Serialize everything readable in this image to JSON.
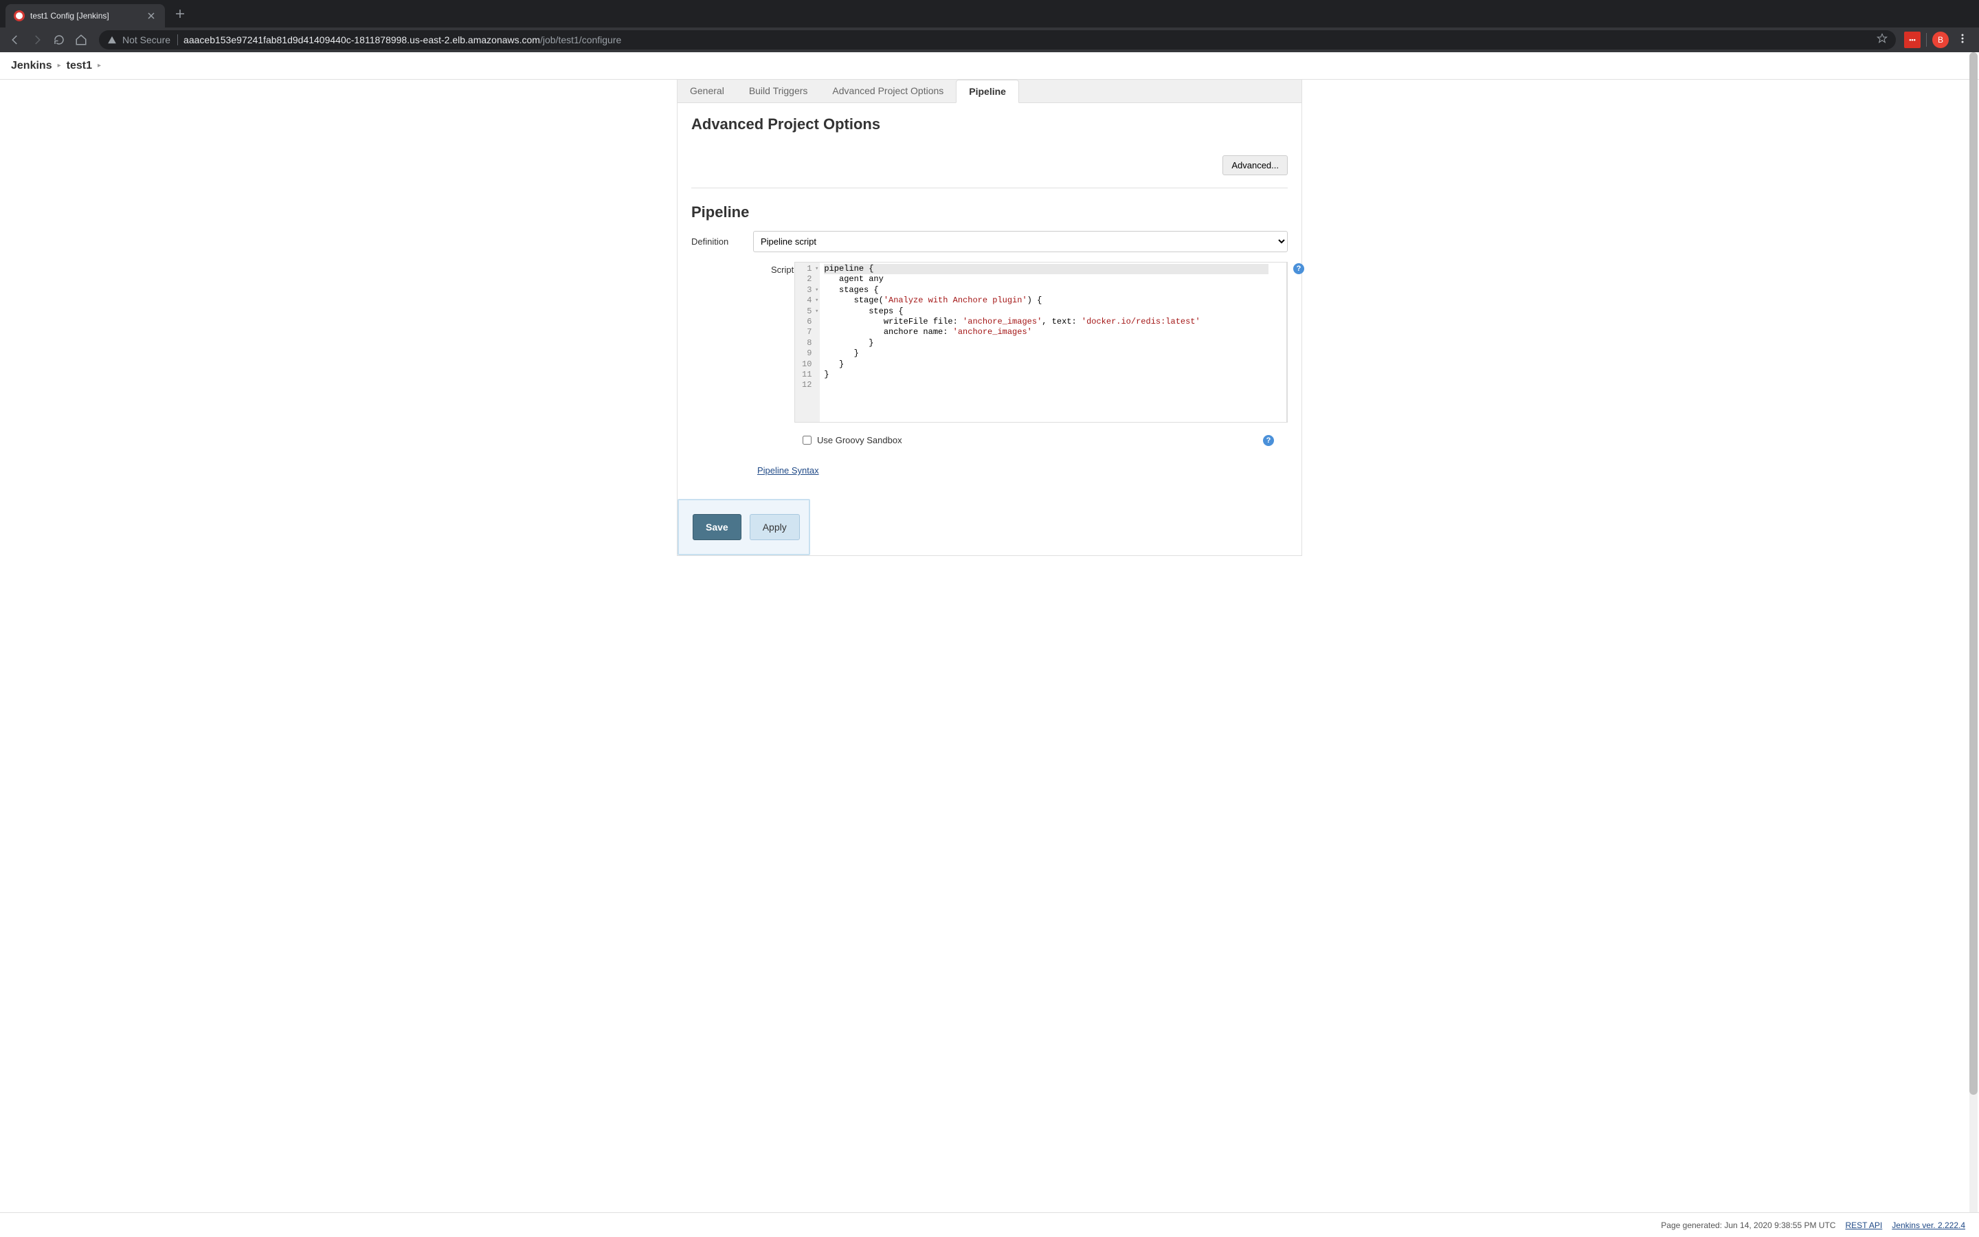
{
  "browser": {
    "tab_title": "test1 Config [Jenkins]",
    "security_label": "Not Secure",
    "url_host": "aaaceb153e97241fab81d9d41409440c-1811878998.us-east-2.elb.amazonaws.com",
    "url_path": "/job/test1/configure",
    "avatar_letter": "B",
    "extension_label": "•••"
  },
  "breadcrumbs": {
    "items": [
      "Jenkins",
      "test1"
    ]
  },
  "tabs": {
    "items": [
      "General",
      "Build Triggers",
      "Advanced Project Options",
      "Pipeline"
    ],
    "active_index": 3
  },
  "sections": {
    "advanced_heading": "Advanced Project Options",
    "advanced_button": "Advanced...",
    "pipeline_heading": "Pipeline"
  },
  "form": {
    "definition_label": "Definition",
    "definition_value": "Pipeline script",
    "script_label": "Script",
    "sandbox_label": "Use Groovy Sandbox",
    "sandbox_checked": false,
    "syntax_link": "Pipeline Syntax",
    "save_label": "Save",
    "apply_label": "Apply",
    "help_glyph": "?"
  },
  "code": {
    "line_numbers": [
      "1",
      "2",
      "3",
      "4",
      "5",
      "6",
      "7",
      "8",
      "9",
      "10",
      "11",
      "12"
    ],
    "fold_lines": [
      1,
      3,
      4,
      5
    ],
    "tokens": [
      [
        {
          "t": "pipeline {",
          "c": ""
        }
      ],
      [
        {
          "t": "   agent any",
          "c": ""
        }
      ],
      [
        {
          "t": "   stages {",
          "c": ""
        }
      ],
      [
        {
          "t": "      stage(",
          "c": ""
        },
        {
          "t": "'Analyze with Anchore plugin'",
          "c": "hlstr"
        },
        {
          "t": ") {",
          "c": ""
        }
      ],
      [
        {
          "t": "         steps {",
          "c": ""
        }
      ],
      [
        {
          "t": "            writeFile file: ",
          "c": ""
        },
        {
          "t": "'anchore_images'",
          "c": "hlstr"
        },
        {
          "t": ", text: ",
          "c": ""
        },
        {
          "t": "'docker.io/redis:latest'",
          "c": "hlstr"
        }
      ],
      [
        {
          "t": "            anchore name: ",
          "c": ""
        },
        {
          "t": "'anchore_images'",
          "c": "hlstr"
        }
      ],
      [
        {
          "t": "         }",
          "c": ""
        }
      ],
      [
        {
          "t": "      }",
          "c": ""
        }
      ],
      [
        {
          "t": "   }",
          "c": ""
        }
      ],
      [
        {
          "t": "}",
          "c": ""
        }
      ],
      [
        {
          "t": "",
          "c": ""
        }
      ]
    ]
  },
  "footer": {
    "generated": "Page generated: Jun 14, 2020 9:38:55 PM UTC",
    "rest_api": "REST API",
    "version": "Jenkins ver. 2.222.4"
  }
}
